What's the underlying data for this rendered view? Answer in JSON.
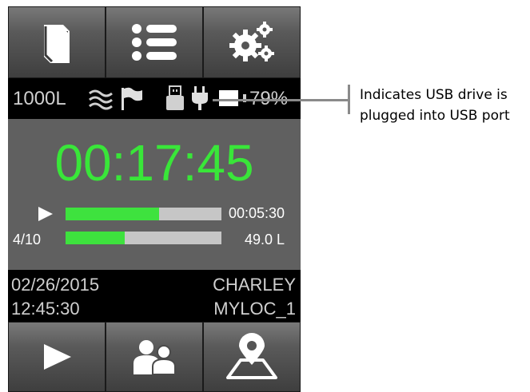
{
  "toolbar": {
    "buttons": [
      {
        "icon": "book-icon"
      },
      {
        "icon": "list-icon"
      },
      {
        "icon": "settings-gears-icon"
      }
    ]
  },
  "status": {
    "volume": "1000L",
    "battery_percent": "79%",
    "battery_level": 0.79,
    "icons": [
      "flow-waves-icon",
      "flag-icon",
      "usb-drive-icon",
      "power-plug-icon",
      "battery-icon"
    ]
  },
  "main": {
    "timer": "00:17:45",
    "progress1": {
      "label_icon": "play-icon",
      "value": "00:05:30",
      "fill_fraction": 0.6
    },
    "progress2": {
      "label": "4/10",
      "value": "49.0 L",
      "fill_fraction": 0.38
    }
  },
  "info": {
    "date": "02/26/2015",
    "time": "12:45:30",
    "user": "CHARLEY",
    "location": "MYLOC_1"
  },
  "bottombar": {
    "buttons": [
      {
        "icon": "play-icon"
      },
      {
        "icon": "users-icon"
      },
      {
        "icon": "map-location-icon"
      }
    ]
  },
  "callout": {
    "line1": "Indicates USB drive is",
    "line2": "plugged into USB port"
  },
  "colors": {
    "accent_green": "#39e639",
    "bar_fill": "#3ee23e",
    "panel_gray": "#606060"
  }
}
